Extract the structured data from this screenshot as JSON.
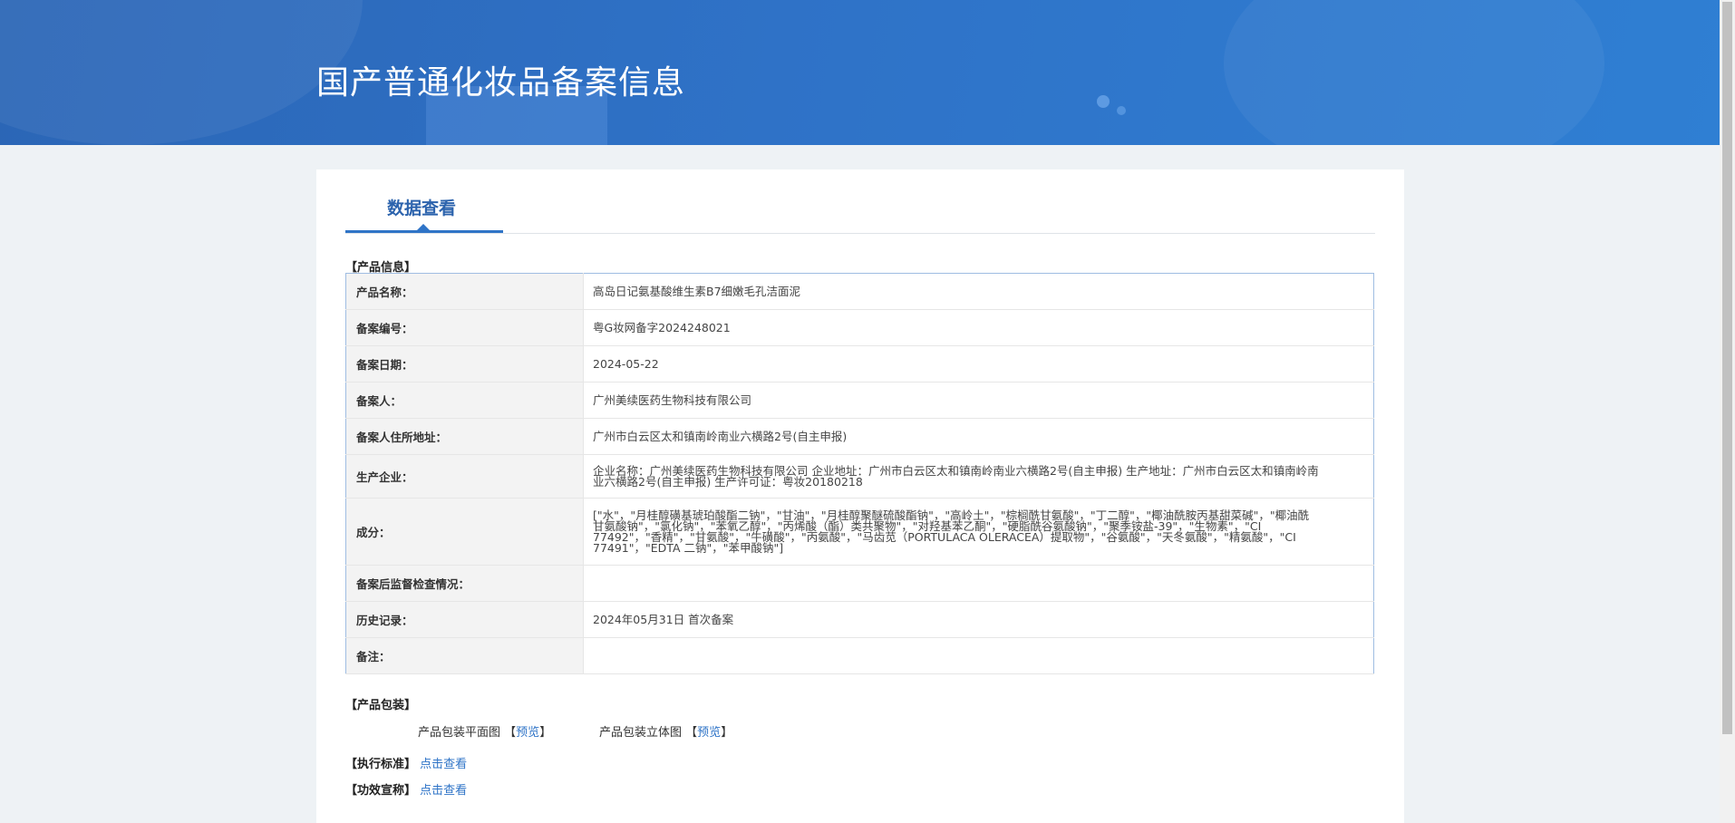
{
  "header": {
    "title": "国产普通化妆品备案信息"
  },
  "tabs": [
    {
      "label": "数据查看"
    }
  ],
  "product_info": {
    "section_title": "【产品信息】",
    "rows": [
      {
        "label": "产品名称：",
        "value": "高岛日记氨基酸维生素B7细嫩毛孔洁面泥"
      },
      {
        "label": "备案编号：",
        "value": "粤G妆网备字2024248021"
      },
      {
        "label": "备案日期：",
        "value": "2024-05-22"
      },
      {
        "label": "备案人：",
        "value": "广州美续医药生物科技有限公司"
      },
      {
        "label": "备案人住所地址：",
        "value": "广州市白云区太和镇南岭南业六横路2号(自主申报)"
      },
      {
        "label": "生产企业：",
        "value": "企业名称：广州美续医药生物科技有限公司 企业地址：广州市白云区太和镇南岭南业六横路2号(自主申报) 生产地址：广州市白云区太和镇南岭南业六横路2号(自主申报) 生产许可证：粤妆20180218"
      },
      {
        "label": "成分：",
        "value": "[\"水\"，\"月桂醇磺基琥珀酸酯二钠\"，\"甘油\"，\"月桂醇聚醚硫酸酯钠\"，\"高岭土\"，\"棕榈酰甘氨酸\"，\"丁二醇\"，\"椰油酰胺丙基甜菜碱\"，\"椰油酰甘氨酸钠\"，\"氯化钠\"，\"苯氧乙醇\"，\"丙烯酸（酯）类共聚物\"，\"对羟基苯乙酮\"，\"硬脂酰谷氨酸钠\"，\"聚季铵盐-39\"，\"生物素\"，\"CI 77492\"，\"香精\"，\"甘氨酸\"，\"牛磺酸\"，\"丙氨酸\"，\"马齿苋（PORTULACA OLERACEA）提取物\"，\"谷氨酸\"，\"天冬氨酸\"，\"精氨酸\"，\"CI 77491\"，\"EDTA 二钠\"，\"苯甲酸钠\"]"
      },
      {
        "label": "备案后监督检查情况：",
        "value": ""
      },
      {
        "label": "历史记录：",
        "value": "2024年05月31日 首次备案"
      },
      {
        "label": "备注：",
        "value": ""
      }
    ]
  },
  "packaging": {
    "section_title": "【产品包装】",
    "items": [
      {
        "name": "产品包装平面图",
        "open": "【",
        "link": "预览",
        "close": "】"
      },
      {
        "name": "产品包装立体图",
        "open": "【",
        "link": "预览",
        "close": "】"
      }
    ]
  },
  "standard": {
    "label": "【执行标准】",
    "link": "点击查看"
  },
  "efficacy": {
    "label": "【功效宣称】",
    "link": "点击查看"
  }
}
